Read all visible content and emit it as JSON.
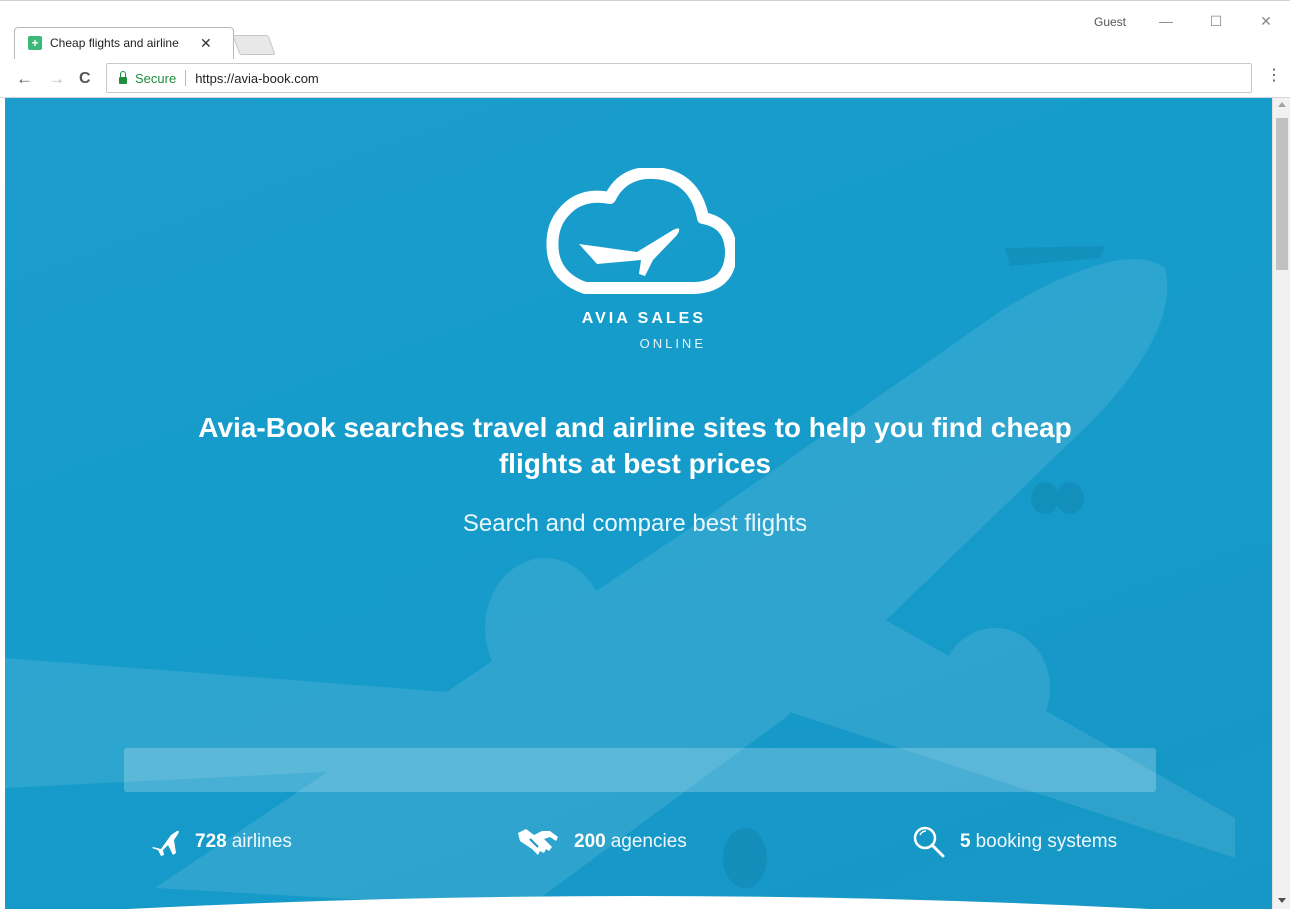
{
  "browser": {
    "tab_title": "Cheap flights and airline",
    "tab_close": "✕",
    "profile": "Guest",
    "minimize": "—",
    "maximize": "☐",
    "close": "✕",
    "back": "←",
    "forward": "→",
    "reload": "C",
    "secure_label": "Secure",
    "url": "https://avia-book.com",
    "menu": "⋮"
  },
  "page": {
    "brand_name": "AVIA SALES",
    "brand_sub": "ONLINE",
    "headline": "Avia-Book searches travel and airline sites to help you find cheap flights at best prices",
    "subheadline": "Search and compare best flights",
    "search_placeholder": "",
    "stats": [
      {
        "icon": "airplane-icon",
        "number": "728",
        "label": "airlines"
      },
      {
        "icon": "handshake-icon",
        "number": "200",
        "label": "agencies"
      },
      {
        "icon": "search-icon",
        "number": "5",
        "label": "booking systems"
      }
    ]
  },
  "colors": {
    "hero_blue": "#1c9ccc",
    "secure_green": "#1e8e3e"
  }
}
